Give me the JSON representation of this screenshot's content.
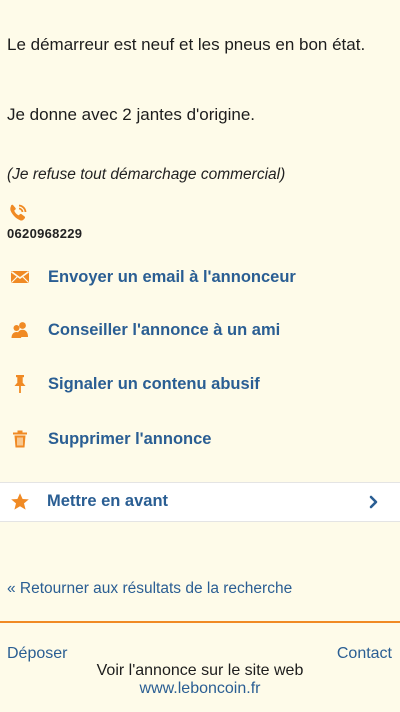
{
  "ad": {
    "description_1": "Le démarreur est neuf et les pneus en bon état.",
    "description_2": "Je donne avec 2 jantes d'origine.",
    "note": "(Je refuse tout démarchage commercial)",
    "phone": "0620968229"
  },
  "actions": {
    "email": "Envoyer un email à l'annonceur",
    "recommend": "Conseiller l'annonce à un ami",
    "report": "Signaler un contenu abusif",
    "delete": "Supprimer l'annonce"
  },
  "feature": {
    "label": "Mettre en avant"
  },
  "navigation": {
    "back": "« Retourner aux résultats de la recherche"
  },
  "footer": {
    "post": "Déposer",
    "contact": "Contact",
    "view_site": "Voir l'annonce sur le site web",
    "url": "www.leboncoin.fr"
  },
  "colors": {
    "accent": "#f08a24",
    "link": "#2a5e93",
    "background": "#fefbe9"
  },
  "icons": [
    "phone-icon",
    "envelope-icon",
    "users-icon",
    "pin-icon",
    "trash-icon",
    "star-icon",
    "chevron-right-icon"
  ]
}
